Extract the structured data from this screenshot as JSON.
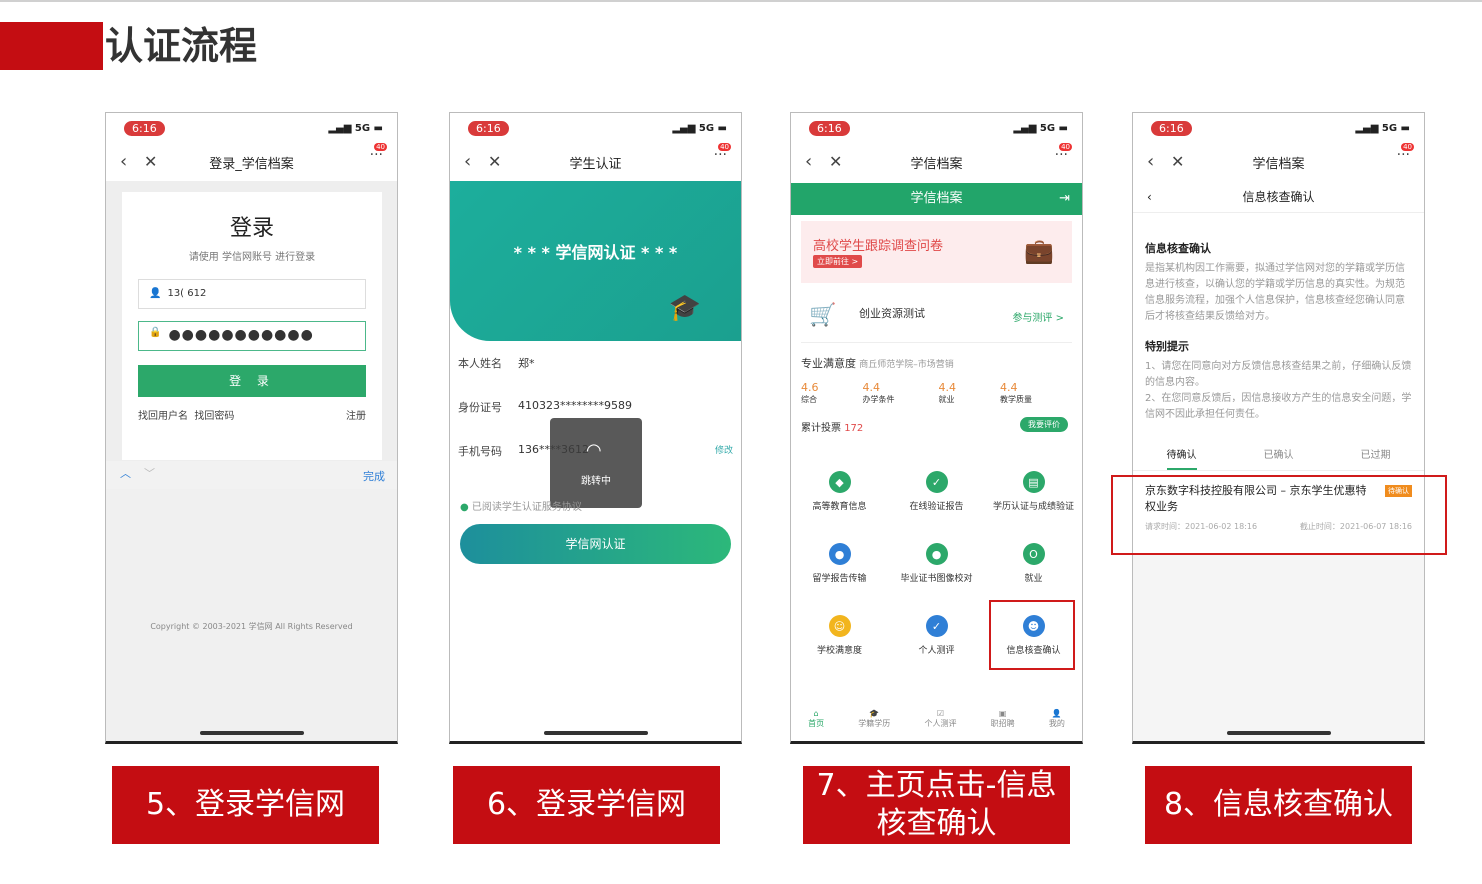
{
  "page": {
    "title": "认证流程"
  },
  "common": {
    "time": "6:16",
    "signal": "5G",
    "badge": "40"
  },
  "phone1": {
    "nav_title": "登录_学信档案",
    "heading": "登录",
    "subtitle": "请使用 学信网账号 进行登录",
    "username_value": "13(         612",
    "password_value": "●●●●●●●●●●●",
    "login_btn": "登 录",
    "link_user": "找回用户名",
    "link_pwd": "找回密码",
    "link_register": "注册",
    "keyboard_done": "完成",
    "copyright": "Copyright © 2003-2021 学信网 All Rights Reserved",
    "caption": "5、登录学信网"
  },
  "phone2": {
    "nav_title": "学生认证",
    "banner": "* * *  学信网认证  * * *",
    "name_label": "本人姓名",
    "name_value": "郑*",
    "id_label": "身份证号",
    "id_value": "410323********9589",
    "phone_label": "手机号码",
    "phone_value": "136****3612",
    "edit": "修改",
    "toast": "跳转中",
    "agree": "已阅读学生认证服务协议",
    "button": "学信网认证",
    "caption": "6、登录学信网"
  },
  "phone3": {
    "nav_title": "学信档案",
    "header": "学信档案",
    "survey_title": "高校学生跟踪调查问卷",
    "survey_btn": "立即前往 >",
    "test_title": "创业资源测试",
    "test_link": "参与测评 >",
    "score_title": "专业满意度",
    "score_school": "商丘师范学院–市场营销",
    "scores": [
      {
        "v": "4.6",
        "l": "综合"
      },
      {
        "v": "4.4",
        "l": "办学条件"
      },
      {
        "v": "4.4",
        "l": "就业"
      },
      {
        "v": "4.4",
        "l": "教学质量"
      }
    ],
    "votes_label": "累计投票",
    "votes_value": "172",
    "rate_btn": "我要评价",
    "grid": [
      {
        "label": "高等教育信息",
        "color": "#2ca86a",
        "glyph": "◆"
      },
      {
        "label": "在线验证报告",
        "color": "#2ca86a",
        "glyph": "✓"
      },
      {
        "label": "学历认证与成绩验证",
        "color": "#2ca86a",
        "glyph": "▤"
      },
      {
        "label": "留学报告传输",
        "color": "#2f7fd6",
        "glyph": "●"
      },
      {
        "label": "毕业证书图像校对",
        "color": "#2ca86a",
        "glyph": "●"
      },
      {
        "label": "就业",
        "color": "#2ca86a",
        "glyph": "O"
      },
      {
        "label": "学校满意度",
        "color": "#f2b51e",
        "glyph": "☺"
      },
      {
        "label": "个人测评",
        "color": "#2f7fd6",
        "glyph": "✓"
      },
      {
        "label": "信息核查确认",
        "color": "#2f7fd6",
        "glyph": "☻"
      }
    ],
    "tabs": [
      "首页",
      "学籍学历",
      "个人测评",
      "职招聘",
      "我的"
    ],
    "caption": "7、主页点击-信息核查确认"
  },
  "phone4": {
    "nav_title": "学信档案",
    "sub_title": "信息核查确认",
    "h1": "信息核查确认",
    "p1": "是指某机构因工作需要，拟通过学信网对您的学籍或学历信息进行核查，以确认您的学籍或学历信息的真实性。为规范信息服务流程，加强个人信息保护，信息核查经您确认同意后才将核查结果反馈给对方。",
    "h2": "特别提示",
    "p2": "1、请您在同意向对方反馈信息核查结果之前，仔细确认反馈的信息内容。",
    "p3": "2、在您同意反馈后，因信息接收方产生的信息安全问题，学信网不因此承担任何责任。",
    "tabs": [
      "待确认",
      "已确认",
      "已过期"
    ],
    "item_title": "京东数字科技控股有限公司 – 京东学生优惠特权业务",
    "item_tag": "待确认",
    "item_req": "请求时间：2021-06-02 18:16",
    "item_end": "截止时间：2021-06-07 18:16",
    "caption": "8、信息核查确认"
  }
}
